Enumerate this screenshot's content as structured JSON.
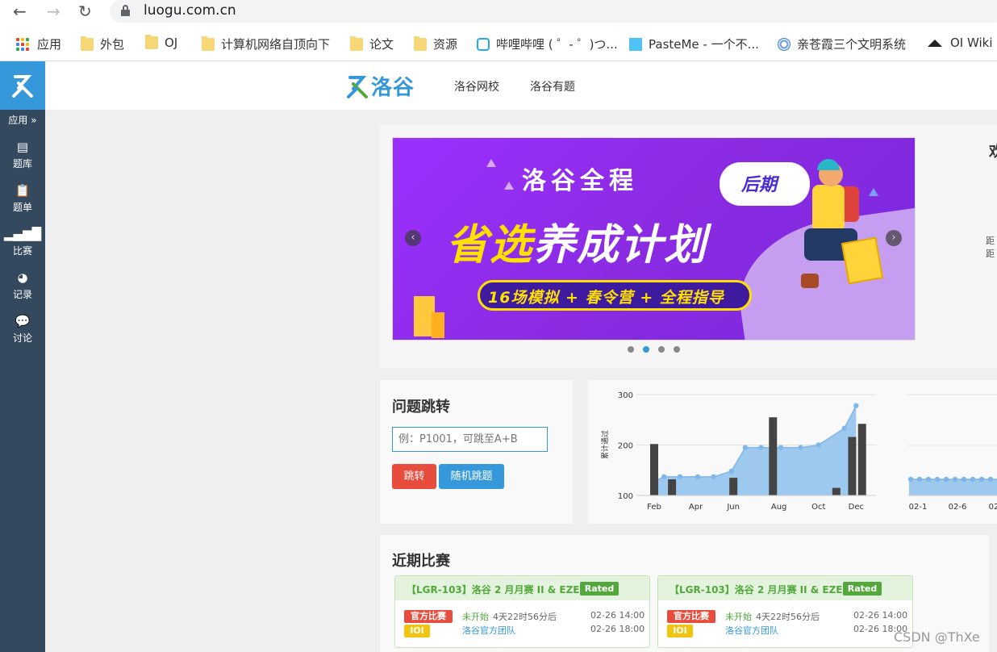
{
  "browser": {
    "back": "←",
    "forward": "→",
    "reload": "↻",
    "url": "luogu.com.cn",
    "bookmarks": [
      {
        "label": "应用",
        "icon": "apps-grid-icon"
      },
      {
        "label": "外包",
        "icon": "folder-icon"
      },
      {
        "label": "OJ",
        "icon": "folder-icon"
      },
      {
        "label": "计算机网络自顶向下",
        "icon": "folder-icon"
      },
      {
        "label": "论文",
        "icon": "folder-icon"
      },
      {
        "label": "资源",
        "icon": "folder-icon"
      },
      {
        "label": "哔哩哔哩 ( ゜- ゜)つ...",
        "icon": "bilibili-icon"
      },
      {
        "label": "PasteMe - 一个不...",
        "icon": "pasteme-icon"
      },
      {
        "label": "亲苍霞三个文明系统",
        "icon": "globe-icon"
      },
      {
        "label": "OI Wiki",
        "icon": "graduation-cap-icon"
      }
    ]
  },
  "sidebar": {
    "apps_label": "应用",
    "items": [
      {
        "label": "题库",
        "icon": "book-icon"
      },
      {
        "label": "题单",
        "icon": "clipboard-icon"
      },
      {
        "label": "比赛",
        "icon": "bar-signal-icon"
      },
      {
        "label": "记录",
        "icon": "pie-icon"
      },
      {
        "label": "讨论",
        "icon": "comments-icon"
      }
    ]
  },
  "header": {
    "brand": "洛谷",
    "nav": [
      "洛谷网校",
      "洛谷有题"
    ]
  },
  "banner": {
    "line1": "洛谷全程",
    "line2a": "省选",
    "line2b": "养成计划",
    "line3": "16场模拟 + 春令营 + 全程指导",
    "bubble": "后期",
    "side_peek": {
      "title": "欢",
      "line1": "距",
      "line2": "距"
    }
  },
  "jump": {
    "title": "问题跳转",
    "placeholder": "例：P1001，可跳至A+B",
    "jump_btn": "跳转",
    "random_btn": "随机跳题"
  },
  "chart_data": [
    {
      "type": "bar",
      "ylabel": "累计通过",
      "ylim": [
        100,
        300
      ],
      "yticks": [
        "300",
        "200",
        "100"
      ],
      "xticks": [
        "Feb",
        "Apr",
        "Jun",
        "Aug",
        "Oct",
        "Dec"
      ],
      "bars": [
        {
          "x": 1.0,
          "value": 202
        },
        {
          "x": 2.0,
          "value": 132
        },
        {
          "x": 6.0,
          "value": 135
        },
        {
          "x": 7.0,
          "value": 255
        },
        {
          "x": 10.0,
          "value": 115
        },
        {
          "x": 11.0,
          "value": 216
        },
        {
          "x": 11.5,
          "value": 242
        }
      ],
      "area": {
        "x": [
          1.0,
          2.0,
          3.0,
          4.0,
          5.0,
          6.0,
          7.0,
          8.0,
          9.0,
          10.0,
          11.0,
          11.5
        ],
        "values": [
          128,
          137,
          137,
          137,
          137,
          148,
          195,
          195,
          195,
          195,
          200,
          233,
          278
        ]
      }
    },
    {
      "type": "line",
      "xticks": [
        "02-1",
        "02-6",
        "02"
      ],
      "values": [
        130,
        130,
        130,
        130,
        130,
        130,
        130,
        130,
        130,
        130,
        130
      ]
    }
  ],
  "contests": {
    "title": "近期比赛",
    "items": [
      {
        "name": "【LGR-103】洛谷 2 月月赛 II & EZEC...",
        "rated": "Rated",
        "tag1": "官方比赛",
        "tag2": "IOI",
        "status": "未开始",
        "countdown": "4天22时56分后",
        "team": "洛谷官方团队",
        "start": "02-26 14:00",
        "end": "02-26 18:00"
      },
      {
        "name": "【LGR-103】洛谷 2 月月赛 II & EZEC...",
        "rated": "Rated",
        "tag1": "官方比赛",
        "tag2": "IOI",
        "status": "未开始",
        "countdown": "4天22时56分后",
        "team": "洛谷官方团队",
        "start": "02-26 14:00",
        "end": "02-26 18:00"
      }
    ]
  },
  "watermark": "CSDN @ThXe",
  "colors": {
    "brand": "#3498db",
    "sidebar": "#34495e",
    "danger": "#e74c3c",
    "green": "#52a83b",
    "ioi": "#f1c40f"
  }
}
